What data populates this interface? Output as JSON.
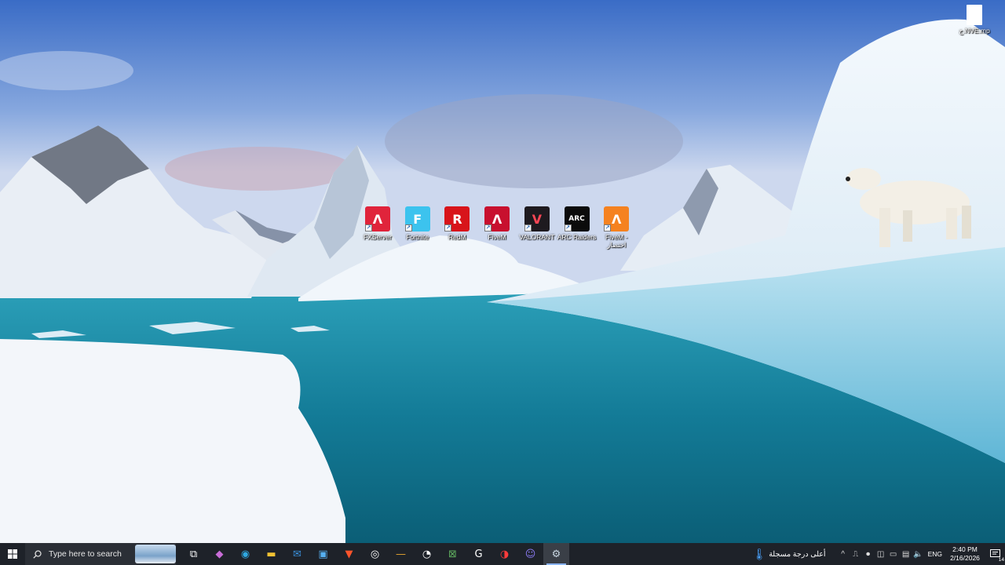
{
  "desktop": {
    "file_icon_label": "ج.NVE.mp",
    "icons": [
      {
        "label": "FXServer",
        "color": "#e0243b",
        "glyph": "Λ",
        "text_color": "#ffffff"
      },
      {
        "label": "Fortnite",
        "color": "#3cc3ee",
        "glyph": "F",
        "text_color": "#ffffff"
      },
      {
        "label": "RedM",
        "color": "#d8141a",
        "glyph": "R",
        "text_color": "#ffffff"
      },
      {
        "label": "FiveM",
        "color": "#c8102e",
        "glyph": "Λ",
        "text_color": "#ffffff"
      },
      {
        "label": "VALORANT",
        "color": "#1e1a1f",
        "glyph": "V",
        "text_color": "#ff4655"
      },
      {
        "label": "ARC Raiders",
        "color": "#0b0b0b",
        "glyph": "ARC",
        "text_color": "#ffffff"
      },
      {
        "label": "FiveM - اختصار",
        "color": "#f58220",
        "glyph": "Λ",
        "text_color": "#ffffff"
      }
    ]
  },
  "taskbar": {
    "search_placeholder": "Type here to search",
    "apps": [
      {
        "name": "task-view",
        "glyph": "⧉",
        "color": "#ffffff"
      },
      {
        "name": "copilot",
        "glyph": "◆",
        "color": "#c86dd7"
      },
      {
        "name": "edge",
        "glyph": "◉",
        "color": "#2fa8e0"
      },
      {
        "name": "file-explorer",
        "glyph": "▬",
        "color": "#f3c233"
      },
      {
        "name": "mail",
        "glyph": "✉",
        "color": "#3a8fd9"
      },
      {
        "name": "store",
        "glyph": "▣",
        "color": "#56b0f0"
      },
      {
        "name": "brave",
        "glyph": "▼",
        "color": "#fb542b"
      },
      {
        "name": "obs",
        "glyph": "◎",
        "color": "#ffffff"
      },
      {
        "name": "dash-app",
        "glyph": "—",
        "color": "#e0a030"
      },
      {
        "name": "speed-app",
        "glyph": "◔",
        "color": "#ffffff"
      },
      {
        "name": "xbox",
        "glyph": "⊠",
        "color": "#5fae5f"
      },
      {
        "name": "epic",
        "glyph": "G",
        "color": "#ffffff"
      },
      {
        "name": "chrome-badge",
        "glyph": "◑",
        "color": "#ff3b3b"
      },
      {
        "name": "discord",
        "glyph": "☺",
        "color": "#8c7cf6"
      },
      {
        "name": "steam",
        "glyph": "⚙",
        "color": "#c7d5e0"
      }
    ],
    "weather_text": "أعلى درجة مسجلة",
    "language": "ENG",
    "time": "2:40 PM",
    "date": "2/16/2026",
    "notification_count": "14"
  }
}
